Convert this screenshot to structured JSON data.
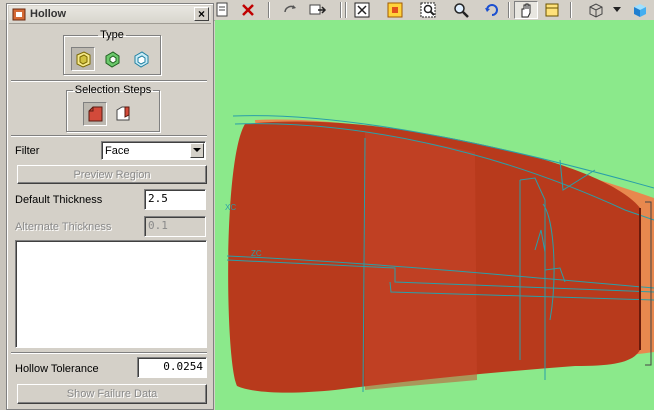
{
  "dialog": {
    "title": "Hollow",
    "close_glyph": "×",
    "type_group": {
      "legend": "Type",
      "icons": [
        "face-hollow-icon",
        "region-hollow-icon",
        "body-hollow-icon"
      ]
    },
    "selection_group": {
      "legend": "Selection Steps",
      "icons": [
        "face-select-icon",
        "alternate-face-icon"
      ]
    },
    "filter": {
      "label": "Filter",
      "value": "Face"
    },
    "preview_button": "Preview Region",
    "default_thickness": {
      "label": "Default Thickness",
      "value": "2.5"
    },
    "alternate_thickness": {
      "label": "Alternate Thickness",
      "value": "0.1"
    },
    "hollow_tolerance": {
      "label": "Hollow Tolerance",
      "value": "0.0254"
    },
    "failure_button": "Show Failure Data"
  },
  "toolbar": {
    "icons": [
      "document-icon",
      "delete-icon",
      "rotate-icon",
      "pan-icon",
      "fit-icon",
      "zoom-box-icon",
      "zoom-region-icon",
      "zoom-icon",
      "refresh-icon",
      "pan-hand-icon",
      "toolbar-icon",
      "view-cube-icon",
      "shaded-cube-icon"
    ]
  },
  "viewport": {
    "background": "#8be98b",
    "body_color": "#b83a1c",
    "edge_color": "#2a9fa8",
    "axis_labels": [
      "XC",
      "ZC"
    ]
  }
}
